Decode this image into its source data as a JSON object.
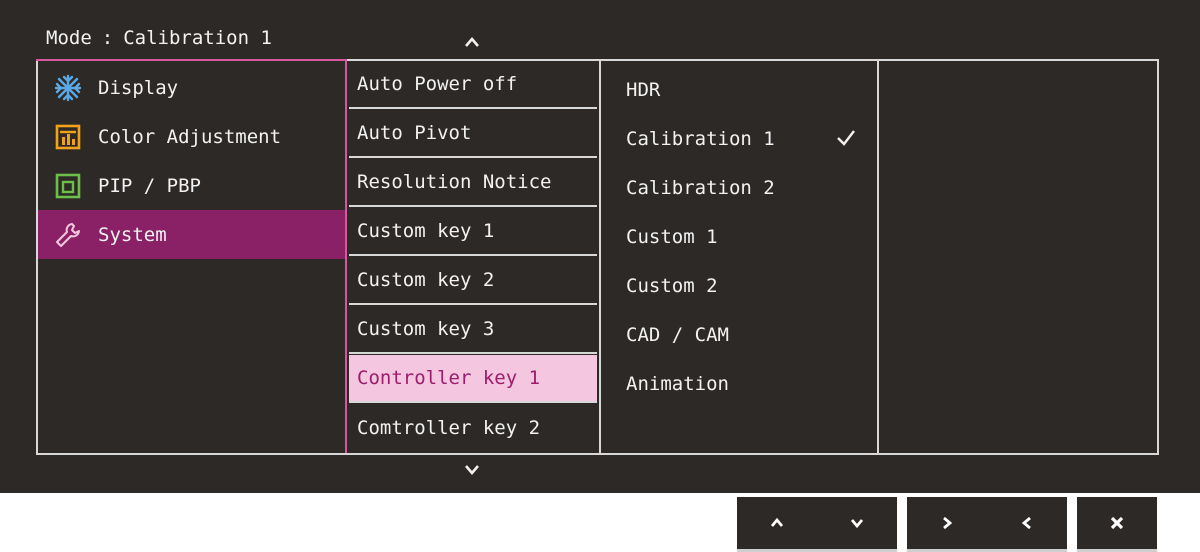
{
  "header": {
    "mode_label": "Mode",
    "mode_separator": ":",
    "mode_value": "Calibration 1"
  },
  "main_menu": [
    {
      "label": "Display",
      "icon": "display-snowflake-icon",
      "icon_color": "#5aa9e6"
    },
    {
      "label": "Color Adjustment",
      "icon": "color-adjustment-icon",
      "icon_color": "#f0a21b"
    },
    {
      "label": "PIP / PBP",
      "icon": "pip-pbp-icon",
      "icon_color": "#6cc04a"
    },
    {
      "label": "System",
      "icon": "wrench-icon",
      "icon_color": "#f5c6df",
      "active": true
    }
  ],
  "submenu": [
    {
      "label": "Auto Power off"
    },
    {
      "label": "Auto Pivot"
    },
    {
      "label": "Resolution Notice"
    },
    {
      "label": "Custom key 1"
    },
    {
      "label": "Custom key 2"
    },
    {
      "label": "Custom key 3"
    },
    {
      "label": "Controller key 1",
      "selected": true
    },
    {
      "label": "Comtroller key 2"
    }
  ],
  "options": [
    {
      "label": "HDR"
    },
    {
      "label": "Calibration 1",
      "checked": true
    },
    {
      "label": "Calibration 2"
    },
    {
      "label": "Custom 1"
    },
    {
      "label": "Custom 2"
    },
    {
      "label": "CAD / CAM"
    },
    {
      "label": "Animation"
    }
  ],
  "controls": {
    "up": "up-arrow-icon",
    "down": "down-arrow-icon",
    "right": "right-arrow-icon",
    "left": "left-arrow-icon",
    "close": "close-icon"
  },
  "colors": {
    "background": "#2d2926",
    "active_menu": "#8a2166",
    "selected_item_bg": "#f5c6df",
    "selected_item_text": "#9b1d6c",
    "accent_line": "#d6589b"
  }
}
